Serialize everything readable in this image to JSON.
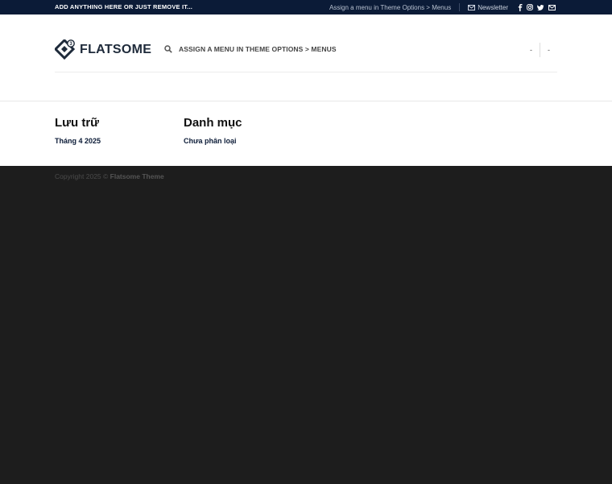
{
  "topbar": {
    "promo": "ADD ANYTHING HERE OR JUST REMOVE IT...",
    "menu_hint": "Assign a menu in Theme Options > Menus",
    "newsletter": "Newsletter",
    "social_icons": [
      "facebook-icon",
      "instagram-icon",
      "twitter-icon",
      "email-icon"
    ]
  },
  "header": {
    "logo_text": "FLATSOME",
    "nav_link": "ASSIGN A MENU IN THEME OPTIONS > MENUS",
    "right_items": [
      "-",
      "-"
    ]
  },
  "widgets": [
    {
      "title": "Lưu trữ",
      "link": "Tháng 4 2025"
    },
    {
      "title": "Danh mục",
      "link": "Chưa phân loại"
    }
  ],
  "footer": {
    "copyright_prefix": "Copyright 2025 ©",
    "copyright_brand": "Flatsome Theme"
  },
  "colors": {
    "topbar_bg": "#0b1b37",
    "footer_bg": "#1d1d1d",
    "accent": "#0b1b37"
  }
}
